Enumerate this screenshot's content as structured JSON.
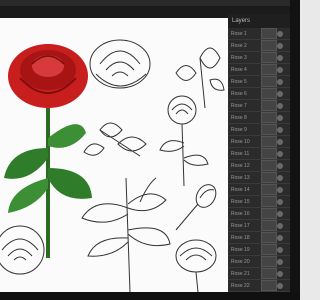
{
  "app": {
    "panel_title": "Layers"
  },
  "colors": {
    "bezel": "#1b1b1b",
    "canvas": "#fbfbfb",
    "panel": "#2b2b2b",
    "rose_red": "#c81e1e",
    "leaf_green": "#2f7d2a",
    "stroke": "#333333"
  },
  "layers": [
    {
      "name": "Rose 1"
    },
    {
      "name": "Rose 2"
    },
    {
      "name": "Rose 3"
    },
    {
      "name": "Rose 4"
    },
    {
      "name": "Rose 5"
    },
    {
      "name": "Rose 6"
    },
    {
      "name": "Rose 7"
    },
    {
      "name": "Rose 8"
    },
    {
      "name": "Rose 9"
    },
    {
      "name": "Rose 10"
    },
    {
      "name": "Rose 11"
    },
    {
      "name": "Rose 12"
    },
    {
      "name": "Rose 13"
    },
    {
      "name": "Rose 14"
    },
    {
      "name": "Rose 15"
    },
    {
      "name": "Rose 16"
    },
    {
      "name": "Rose 17"
    },
    {
      "name": "Rose 18"
    },
    {
      "name": "Rose 19"
    },
    {
      "name": "Rose 20"
    },
    {
      "name": "Rose 21"
    },
    {
      "name": "Rose 22"
    },
    {
      "name": "Rose 23"
    }
  ]
}
